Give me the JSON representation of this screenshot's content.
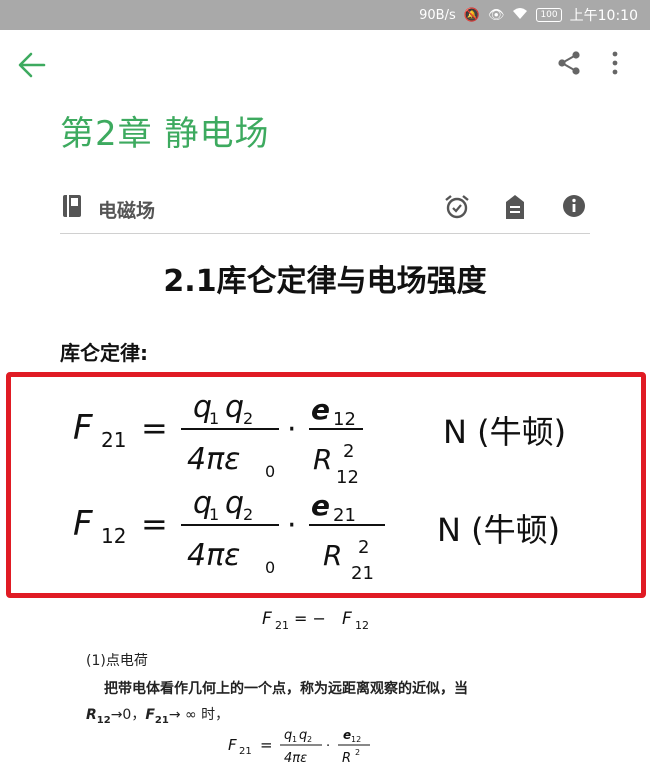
{
  "status_bar": {
    "network_speed": "90B/s",
    "battery": "100",
    "time": "上午10:10"
  },
  "toolbar": {
    "back_icon": "arrow-left-icon",
    "share_icon": "share-icon",
    "more_icon": "more-vert-icon",
    "accent_color": "#3daa5f"
  },
  "note": {
    "chapter_title": "第2章 静电场",
    "notebook_name": "电磁场",
    "notebook_icon": "notebook-icon",
    "reminder_icon": "alarm-icon",
    "tag_icon": "tag-icon",
    "info_icon": "info-icon"
  },
  "content": {
    "section_heading": "2.1库仑定律与电场强度",
    "law_label": "库仑定律:",
    "highlight_color": "#e01b24",
    "formula1": {
      "lhs": "F",
      "lhs_sub": "21",
      "num_q1": "q",
      "num_q1_sub": "1",
      "num_q2": "q",
      "num_q2_sub": "2",
      "den": "4πε",
      "den_sub": "0",
      "unit_vec": "e",
      "unit_vec_sub": "12",
      "r": "R",
      "r_sub": "12",
      "r_exp": "2",
      "unit": "N (牛顿)"
    },
    "formula2": {
      "lhs": "F",
      "lhs_sub": "12",
      "num_q1": "q",
      "num_q1_sub": "1",
      "num_q2": "q",
      "num_q2_sub": "2",
      "den": "4πε",
      "den_sub": "0",
      "unit_vec": "e",
      "unit_vec_sub": "21",
      "r": "R",
      "r_sub": "21",
      "r_exp": "2",
      "unit": "N (牛顿)"
    },
    "relation": {
      "lhs": "F",
      "lhs_sub": "21",
      "op": "= −",
      "rhs": "F",
      "rhs_sub": "12"
    },
    "point_charge_title": "(1)点电荷",
    "paragraph": "把带电体看作几何上的一个点，称为远距离观察的近似，当",
    "condition": {
      "r": "R",
      "r_sub": "12",
      "r_limit": "→0，",
      "f": "F",
      "f_sub": "21",
      "f_limit": "→ ∞ 时，"
    },
    "formula3": {
      "lhs": "F",
      "lhs_sub": "21",
      "num": "q",
      "num_sub1": "1",
      "num2": "q",
      "num_sub2": "2",
      "den": "4πε",
      "vec": "e",
      "vec_sub": "12",
      "r": "R",
      "r_exp": "2"
    }
  }
}
